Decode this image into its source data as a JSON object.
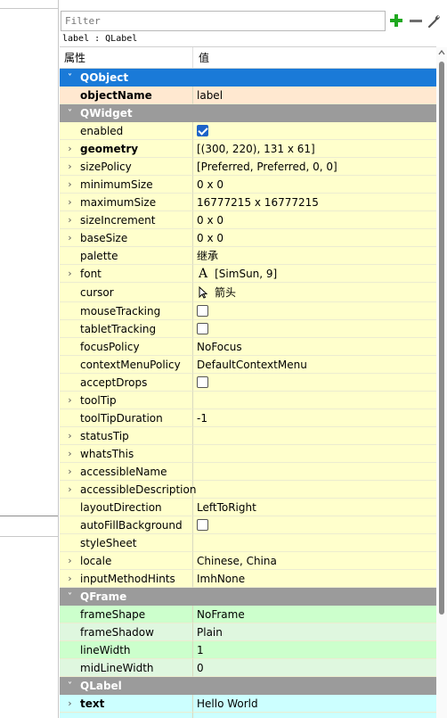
{
  "filter": {
    "placeholder": "Filter"
  },
  "toolbar": {
    "add_label": "+",
    "remove_label": "−"
  },
  "class_label": "label : QLabel",
  "header": {
    "property": "属性",
    "value": "值"
  },
  "colors": {
    "qobject": "#1a7ad8",
    "qwidget": "#9b9b9b",
    "qframe": "#9b9b9b",
    "qlabel": "#9b9b9b"
  },
  "groups": {
    "qobject": "QObject",
    "qwidget": "QWidget",
    "qframe": "QFrame",
    "qlabel": "QLabel"
  },
  "rows": {
    "objectName": {
      "name": "objectName",
      "value": "label"
    },
    "enabled": {
      "name": "enabled",
      "checked": true
    },
    "geometry": {
      "name": "geometry",
      "value": "[(300, 220), 131 x 61]"
    },
    "sizePolicy": {
      "name": "sizePolicy",
      "value": "[Preferred, Preferred, 0, 0]"
    },
    "minimumSize": {
      "name": "minimumSize",
      "value": "0 x 0"
    },
    "maximumSize": {
      "name": "maximumSize",
      "value": "16777215 x 16777215"
    },
    "sizeIncrement": {
      "name": "sizeIncrement",
      "value": "0 x 0"
    },
    "baseSize": {
      "name": "baseSize",
      "value": "0 x 0"
    },
    "palette": {
      "name": "palette",
      "value": "继承"
    },
    "font": {
      "name": "font",
      "icon_glyph": "A",
      "value": "[SimSun, 9]"
    },
    "cursor": {
      "name": "cursor",
      "value": "箭头"
    },
    "mouseTracking": {
      "name": "mouseTracking",
      "checked": false
    },
    "tabletTracking": {
      "name": "tabletTracking",
      "checked": false
    },
    "focusPolicy": {
      "name": "focusPolicy",
      "value": "NoFocus"
    },
    "contextMenuPolicy": {
      "name": "contextMenuPolicy",
      "value": "DefaultContextMenu"
    },
    "acceptDrops": {
      "name": "acceptDrops",
      "checked": false
    },
    "toolTip": {
      "name": "toolTip",
      "value": ""
    },
    "toolTipDuration": {
      "name": "toolTipDuration",
      "value": "-1"
    },
    "statusTip": {
      "name": "statusTip",
      "value": ""
    },
    "whatsThis": {
      "name": "whatsThis",
      "value": ""
    },
    "accessibleName": {
      "name": "accessibleName",
      "value": ""
    },
    "accessibleDescription": {
      "name": "accessibleDescription",
      "value": ""
    },
    "layoutDirection": {
      "name": "layoutDirection",
      "value": "LeftToRight"
    },
    "autoFillBackground": {
      "name": "autoFillBackground",
      "checked": false
    },
    "styleSheet": {
      "name": "styleSheet",
      "value": ""
    },
    "locale": {
      "name": "locale",
      "value": "Chinese, China"
    },
    "inputMethodHints": {
      "name": "inputMethodHints",
      "value": "ImhNone"
    },
    "frameShape": {
      "name": "frameShape",
      "value": "NoFrame"
    },
    "frameShadow": {
      "name": "frameShadow",
      "value": "Plain"
    },
    "lineWidth": {
      "name": "lineWidth",
      "value": "1"
    },
    "midLineWidth": {
      "name": "midLineWidth",
      "value": "0"
    },
    "text": {
      "name": "text",
      "value": "Hello World"
    }
  }
}
